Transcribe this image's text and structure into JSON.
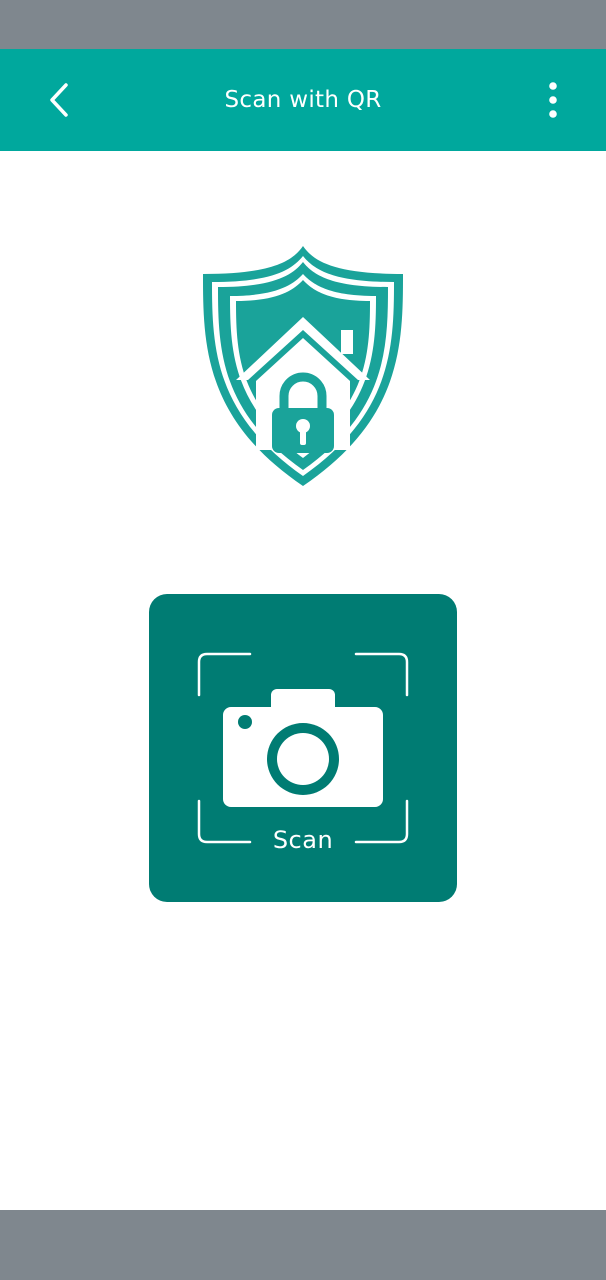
{
  "app_bar": {
    "title": "Scan with QR",
    "back_icon": "chevron-left-icon",
    "menu_icon": "more-vertical-icon"
  },
  "logo": {
    "icon": "shield-home-lock-icon"
  },
  "scan_card": {
    "label": "Scan",
    "icon": "camera-icon"
  },
  "colors": {
    "status_bar": "#7f878e",
    "app_bar": "#00a89d",
    "accent": "#1aa39a",
    "card": "#007c73",
    "nav_bar": "#7f878e",
    "on_primary": "#ffffff"
  }
}
